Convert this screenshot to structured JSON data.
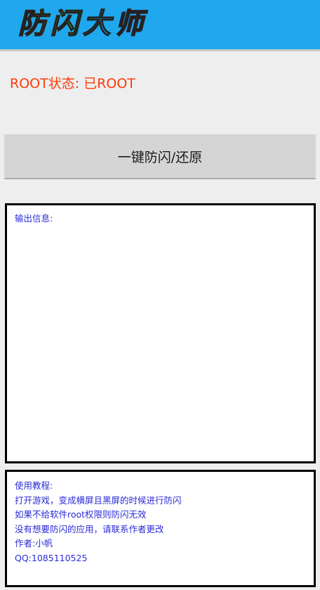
{
  "header": {
    "title": "防闪大师",
    "background_color": "#1fa8ed"
  },
  "status": {
    "root_text": "ROOT状态: 已ROOT",
    "color": "#ff3b0a"
  },
  "main_button": {
    "label": "一键防闪/还原"
  },
  "output": {
    "label": "输出信息:"
  },
  "tutorial": {
    "lines": [
      "使用教程:",
      "打开游戏，变成横屏且黑屏的时候进行防闪",
      "如果不给软件root权限则防闪无效",
      "没有想要防闪的应用，请联系作者更改",
      "作者:小帆",
      "QQ:1085110525"
    ]
  },
  "text_color": "#2b2bd9"
}
